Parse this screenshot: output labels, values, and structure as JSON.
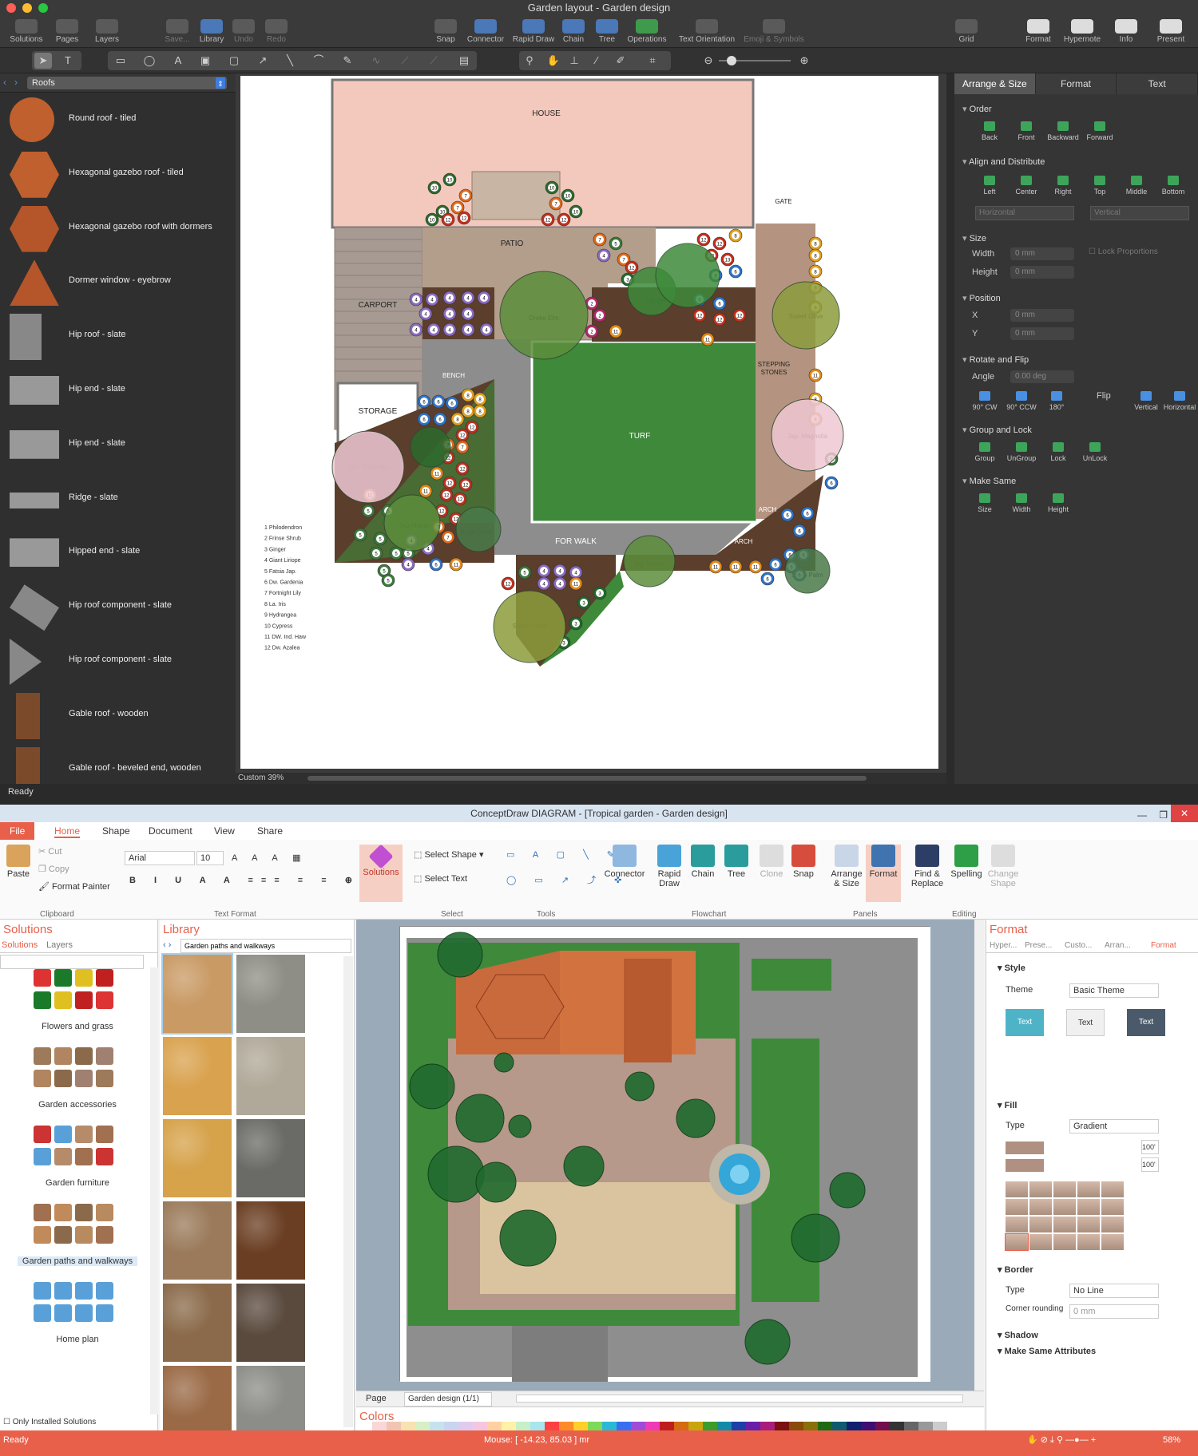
{
  "mac": {
    "title": "Garden layout - Garden design",
    "toolbar": [
      {
        "label": "Solutions"
      },
      {
        "label": "Pages"
      },
      {
        "label": "Layers"
      },
      {
        "label": "Save..."
      },
      {
        "label": "Library"
      },
      {
        "label": "Undo"
      },
      {
        "label": "Redo"
      },
      {
        "label": "Snap"
      },
      {
        "label": "Connector"
      },
      {
        "label": "Rapid Draw"
      },
      {
        "label": "Chain"
      },
      {
        "label": "Tree"
      },
      {
        "label": "Operations"
      },
      {
        "label": "Text Orientation"
      },
      {
        "label": "Emoji & Symbols"
      },
      {
        "label": "Grid"
      },
      {
        "label": "Format"
      },
      {
        "label": "Hypernote"
      },
      {
        "label": "Info"
      },
      {
        "label": "Present"
      }
    ],
    "library": {
      "selected": "Roofs",
      "items": [
        "Round roof - tiled",
        "Hexagonal gazebo roof - tiled",
        "Hexagonal gazebo roof with dormers",
        "Dormer window - eyebrow",
        "Hip roof - slate",
        "Hip end - slate",
        "Hip end - slate",
        "Ridge - slate",
        "Hipped end - slate",
        "Hip roof component - slate",
        "Hip roof component - slate",
        "Gable roof - wooden",
        "Gable roof - beveled end, wooden"
      ]
    },
    "zoom": "Custom 39%",
    "status": "Ready",
    "garden": {
      "labels": {
        "house": "HOUSE",
        "patio": "PATIO",
        "carport": "CARPORT",
        "storage": "STORAGE",
        "bench": "BENCH",
        "turf": "TURF",
        "gate": "GATE",
        "stepping": "STEPPING",
        "stones": "STONES",
        "forwalk": "FOR WALK",
        "arch1": "ARCH",
        "arch2": "ARCH",
        "arch3": "ARCH",
        "locust": "Locust",
        "drake": "Drake Elm",
        "olive1": "Sweet Olive",
        "olive2": "Sweet Olive",
        "magnolia1": "Jap. Magnolia",
        "magnolia2": "Jap. Magnolia",
        "maple1": "Jap Maple",
        "maple2": "Jap Maple",
        "palm1": "Sago Palm",
        "palm2": "Sago Palm"
      },
      "legend": [
        "1   Philodendron",
        "2   Frinse Shrub",
        "3   Ginger",
        "4   Giant Liriope",
        "5   Fatsia Jap.",
        "6   Dw. Gardenia",
        "7   Fortnight Lily",
        "8   La. Iris",
        "9   Hydrangea",
        "10  Cypress",
        "11  DW. Ind. Haw",
        "12  Dw. Azalea"
      ]
    },
    "inspector": {
      "tabs": [
        "Arrange & Size",
        "Format",
        "Text"
      ],
      "order": {
        "title": "Order",
        "buttons": [
          "Back",
          "Front",
          "Backward",
          "Forward"
        ]
      },
      "align": {
        "title": "Align and Distribute",
        "buttons": [
          "Left",
          "Center",
          "Right",
          "Top",
          "Middle",
          "Bottom"
        ],
        "dist": [
          "Horizontal",
          "Vertical"
        ]
      },
      "size": {
        "title": "Size",
        "width_label": "Width",
        "height_label": "Height",
        "width": "0 mm",
        "height": "0 mm",
        "lock": "Lock Proportions"
      },
      "position": {
        "title": "Position",
        "x_label": "X",
        "y_label": "Y",
        "x": "0 mm",
        "y": "0 mm"
      },
      "rotate": {
        "title": "Rotate and Flip",
        "angle_label": "Angle",
        "angle": "0.00 deg",
        "flip": "Flip",
        "buttons": [
          "90° CW",
          "90° CCW",
          "180°"
        ],
        "flip_buttons": [
          "Vertical",
          "Horizontal"
        ]
      },
      "group": {
        "title": "Group and Lock",
        "buttons": [
          "Group",
          "UnGroup",
          "Lock",
          "UnLock"
        ]
      },
      "same": {
        "title": "Make Same",
        "buttons": [
          "Size",
          "Width",
          "Height"
        ]
      }
    }
  },
  "win": {
    "title": "ConceptDraw DIAGRAM - [Tropical garden - Garden design]",
    "menu": [
      "File",
      "Home",
      "Shape",
      "Document",
      "View",
      "Share"
    ],
    "ribbon": {
      "clipboard": {
        "paste": "Paste",
        "cut": "Cut",
        "copy": "Copy",
        "painter": "Format Painter",
        "group": "Clipboard"
      },
      "text": {
        "font": "Arial",
        "size": "10",
        "group": "Text Format"
      },
      "solutions": "Solutions",
      "select": {
        "shape": "Select Shape",
        "text": "Select Text",
        "group": "Select"
      },
      "tools_group": "Tools",
      "flow": {
        "connector": "Connector",
        "rapid": "Rapid Draw",
        "chain": "Chain",
        "tree": "Tree",
        "clone": "Clone",
        "snap": "Snap",
        "group": "Flowchart"
      },
      "panels": {
        "arrange": "Arrange & Size",
        "format": "Format",
        "group": "Panels"
      },
      "editing": {
        "find": "Find & Replace",
        "spelling": "Spelling",
        "change": "Change Shape",
        "group": "Editing"
      }
    },
    "solutions": {
      "title": "Solutions",
      "tabs": [
        "Solutions",
        "Layers"
      ],
      "items": [
        "Flowers and grass",
        "Garden accessories",
        "Garden furniture",
        "Garden paths and walkways",
        "Home plan"
      ],
      "footer": "Only Installed Solutions"
    },
    "library": {
      "title": "Library",
      "selected": "Garden paths and walkways"
    },
    "page": {
      "label": "Page",
      "current": "Garden design (1/1)"
    },
    "colors_title": "Colors",
    "format": {
      "title": "Format",
      "tabs": [
        "Hyper...",
        "Prese...",
        "Custo...",
        "Arran...",
        "Format"
      ],
      "style": "Style",
      "theme_label": "Theme",
      "theme": "Basic Theme",
      "text_sample": "Text",
      "fill": "Fill",
      "type_label": "Type",
      "fill_type": "Gradient",
      "pct1": "100'",
      "pct2": "100'",
      "border": "Border",
      "border_type": "No Line",
      "corner_label": "Corner rounding",
      "corner": "0 mm",
      "shadow": "Shadow",
      "same": "Make Same Attributes"
    },
    "status": {
      "left": "Ready",
      "mouse": "Mouse: [ -14.23, 85.03 ] mr",
      "zoom": "58%"
    }
  }
}
